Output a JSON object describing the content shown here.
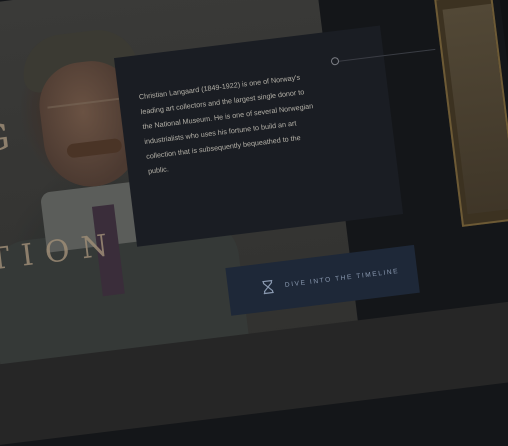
{
  "hero": {
    "letter_top": "G",
    "letter_bottom": "TION"
  },
  "story": {
    "body": "Christian Langaard (1849-1922) is one of Norway's leading art collectors and the largest single donor to the National Museum. He is one of several Norwegian industrialists who uses his fortune to build an art collection that is subsequently bequeathed to the public."
  },
  "timeline": {
    "button_label": "DIVE INTO THE TIMELINE",
    "icon": "hourglass-icon"
  },
  "colors": {
    "card_bg": "#1a1d23",
    "button_bg": "#1e2838",
    "accent_gold": "#6d5a35",
    "heading_letters": "#9d8c76"
  }
}
